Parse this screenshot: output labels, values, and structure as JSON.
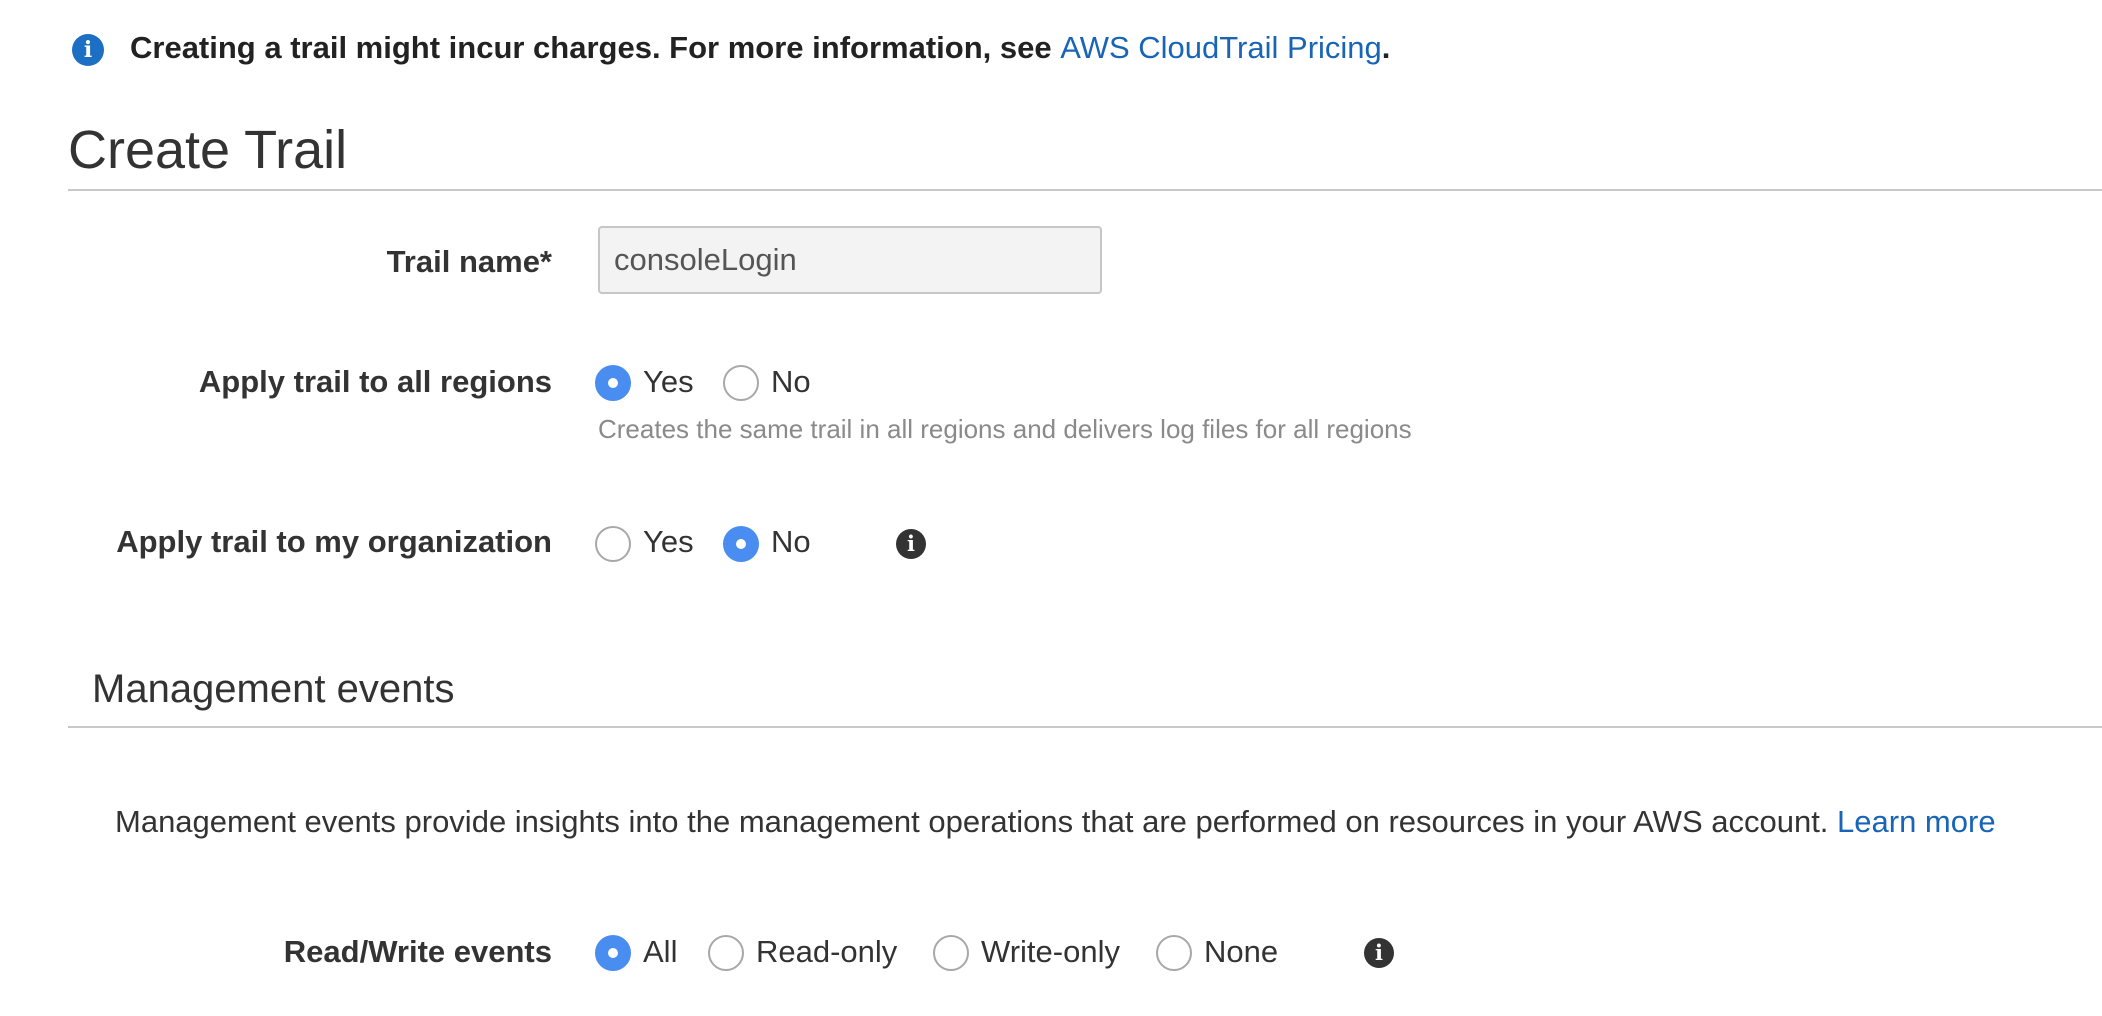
{
  "banner": {
    "text": "Creating a trail might incur charges. For more information, see ",
    "link": "AWS CloudTrail Pricing",
    "end": "."
  },
  "page_title": "Create Trail",
  "trail_name": {
    "label": "Trail name*",
    "value": "consoleLogin"
  },
  "all_regions": {
    "label": "Apply trail to all regions",
    "options": [
      "Yes",
      "No"
    ],
    "selected": "Yes",
    "help": "Creates the same trail in all regions and delivers log files for all regions"
  },
  "organization": {
    "label": "Apply trail to my organization",
    "options": [
      "Yes",
      "No"
    ],
    "selected": "No"
  },
  "management_events": {
    "title": "Management events",
    "description": "Management events provide insights into the management operations that are performed on resources in your AWS account. ",
    "learn_more": "Learn more"
  },
  "read_write": {
    "label": "Read/Write events",
    "options": [
      "All",
      "Read-only",
      "Write-only",
      "None"
    ],
    "selected": "All"
  },
  "icons": {
    "info": "info-icon"
  },
  "colors": {
    "accent": "#4a8df0",
    "link": "#1865b7",
    "banner_icon": "#1d6fc4"
  }
}
